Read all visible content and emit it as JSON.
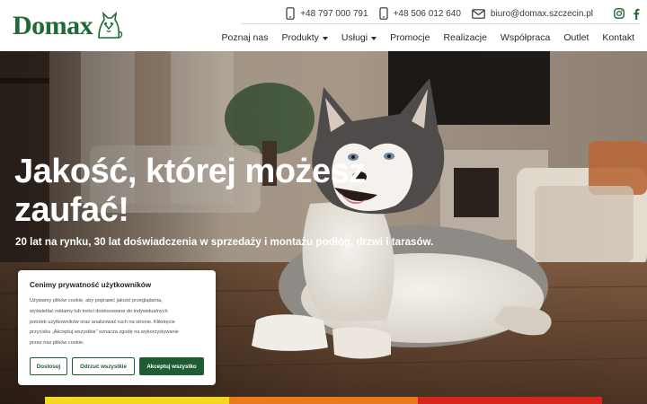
{
  "brand": {
    "name": "Domax",
    "accent": "#1f6b34"
  },
  "topbar": {
    "contacts": [
      {
        "icon": "phone-icon",
        "label": "+48 797 000 791"
      },
      {
        "icon": "phone-icon",
        "label": "+48 506 012 640"
      },
      {
        "icon": "mail-icon",
        "label": "biuro@domax.szczecin.pl"
      }
    ],
    "social": [
      "instagram-icon",
      "facebook-icon"
    ]
  },
  "nav": {
    "items": [
      {
        "label": "Poznaj nas",
        "dropdown": false
      },
      {
        "label": "Produkty",
        "dropdown": true
      },
      {
        "label": "Usługi",
        "dropdown": true
      },
      {
        "label": "Promocje",
        "dropdown": false
      },
      {
        "label": "Realizacje",
        "dropdown": false
      },
      {
        "label": "Współpraca",
        "dropdown": false
      },
      {
        "label": "Outlet",
        "dropdown": false
      },
      {
        "label": "Kontakt",
        "dropdown": false
      }
    ]
  },
  "hero": {
    "title_line1": "Jakość, której możesz",
    "title_line2": "zaufać!",
    "subtitle": "20 lat na rynku, 30 lat doświadczenia w sprzedaży i montażu podłóg, drzwi i tarasów.",
    "stripe_colors": [
      "#f4d820",
      "#ec7a1c",
      "#d8261c"
    ]
  },
  "cookie": {
    "title": "Cenimy prywatność użytkowników",
    "text_lines": [
      "Używamy plików cookie, aby poprawić jakość przeglądania,",
      "wyświetlać reklamy lub treści dostosowane do indywidualnych",
      "potrzeb użytkowników oraz analizować ruch na stronie. Kliknięcie",
      "przycisku „Akceptuj wszystkie” oznacza zgodę na wykorzystywanie",
      "przez nas plików cookie."
    ],
    "buttons": {
      "customize": "Dostosuj",
      "reject": "Odrzuć wszystkie",
      "accept": "Akceptuj wszystko"
    },
    "button_color": "#1f5c32"
  }
}
